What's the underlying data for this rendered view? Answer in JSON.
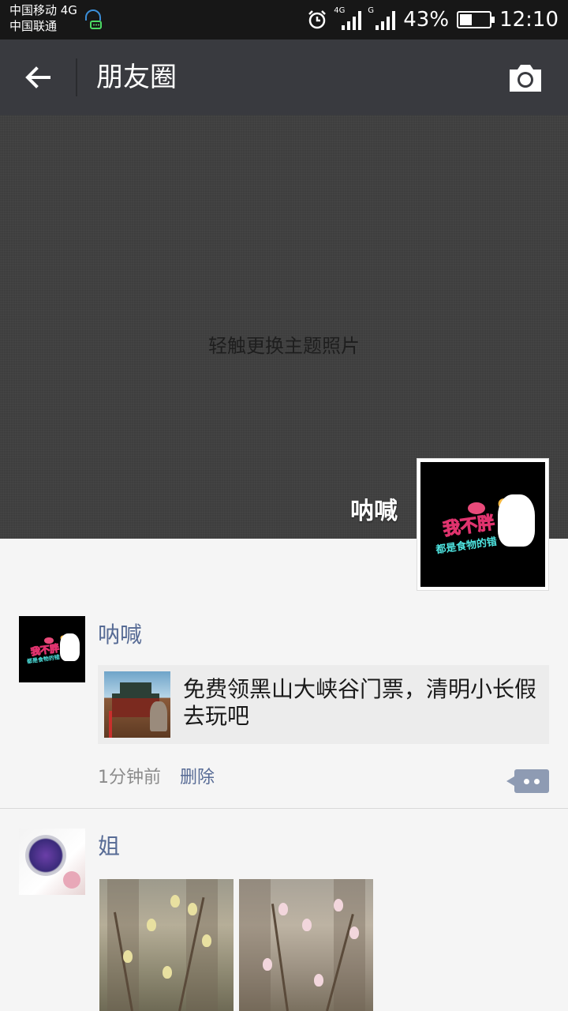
{
  "status_bar": {
    "carrier1": "中国移动 4G",
    "carrier2": "中国联通",
    "signal1_tag": "4G",
    "signal2_tag": "G",
    "battery": "43%",
    "battery_level": 0.43,
    "time": "12:10"
  },
  "nav": {
    "back_icon": "back-arrow-icon",
    "title": "朋友圈",
    "camera_icon": "camera-icon"
  },
  "cover": {
    "hint": "轻触更换主题照片",
    "user_name": "呐喊"
  },
  "avatar_art": {
    "line1": "我不胖",
    "line2": "都是食物的错"
  },
  "posts": [
    {
      "author": "呐喊",
      "share_text": "免费领黑山大峡谷门票，清明小长假去玩吧",
      "time": "1分钟前",
      "delete_label": "删除"
    },
    {
      "author": "姐"
    }
  ],
  "colors": {
    "nav_bg": "#393a3f",
    "link": "#576b95",
    "cover_bg": "#3e3e3e"
  }
}
